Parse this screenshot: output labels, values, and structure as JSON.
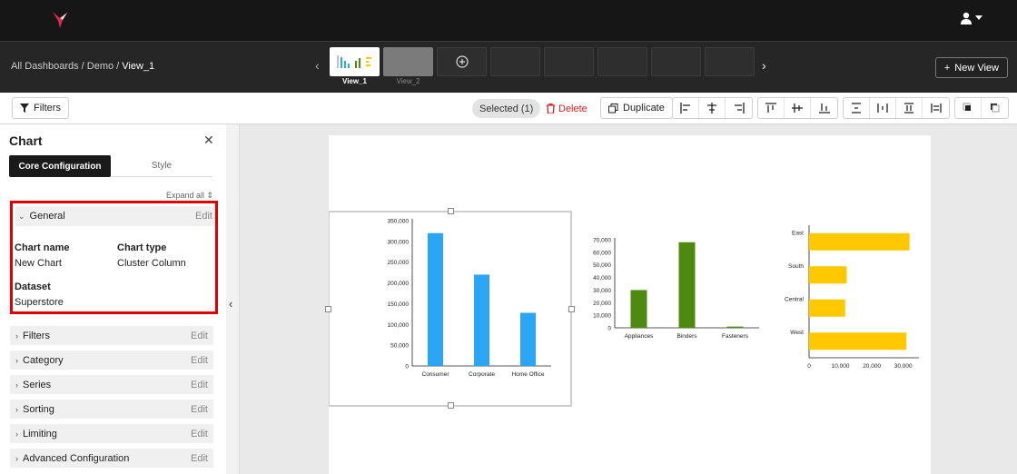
{
  "user": {
    "menu_icon": "user-icon"
  },
  "breadcrumb": {
    "root": "All Dashboards",
    "sep1": " / ",
    "middle": "Demo",
    "sep2": " / ",
    "current": "View_1"
  },
  "views": [
    {
      "label": "View_1",
      "active": true
    },
    {
      "label": "View_2",
      "active": false
    }
  ],
  "new_view_label": "New View",
  "toolbar": {
    "filters_label": "Filters",
    "selected_label": "Selected (1)",
    "delete_label": "Delete",
    "duplicate_label": "Duplicate"
  },
  "panel": {
    "title": "Chart",
    "tabs": [
      "Core Configuration",
      "Style"
    ],
    "expand_all": "Expand all",
    "general": {
      "title": "General",
      "edit": "Edit",
      "chart_name_label": "Chart name",
      "chart_name_value": "New Chart",
      "chart_type_label": "Chart type",
      "chart_type_value": "Cluster Column",
      "dataset_label": "Dataset",
      "dataset_value": "Superstore"
    },
    "sections": [
      {
        "title": "Filters",
        "edit": "Edit"
      },
      {
        "title": "Category",
        "edit": "Edit"
      },
      {
        "title": "Series",
        "edit": "Edit"
      },
      {
        "title": "Sorting",
        "edit": "Edit"
      },
      {
        "title": "Limiting",
        "edit": "Edit"
      },
      {
        "title": "Advanced Configuration",
        "edit": "Edit"
      }
    ]
  },
  "colors": {
    "blue": "#2aa6f5",
    "green": "#4f8a10",
    "yellow": "#ffc800",
    "highlight": "#e00000"
  },
  "chart_data": [
    {
      "type": "bar",
      "categories": [
        "Consumer",
        "Corporate",
        "Home Office"
      ],
      "values": [
        320000,
        220000,
        128000
      ],
      "ylim": [
        0,
        350000
      ],
      "yticks": [
        "0",
        "50,000",
        "100,000",
        "150,000",
        "200,000",
        "250,000",
        "300,000",
        "350,000"
      ]
    },
    {
      "type": "bar",
      "categories": [
        "Appliances",
        "Binders",
        "Fasteners"
      ],
      "values": [
        30000,
        68000,
        1000
      ],
      "ylim": [
        0,
        70000
      ],
      "yticks": [
        "0",
        "10,000",
        "20,000",
        "30,000",
        "40,000",
        "50,000",
        "60,000",
        "70,000"
      ]
    },
    {
      "type": "bar",
      "orientation": "horizontal",
      "categories": [
        "East",
        "South",
        "Central",
        "West"
      ],
      "values": [
        32000,
        12000,
        11500,
        31000
      ],
      "xlim": [
        0,
        35000
      ],
      "xticks": [
        "0",
        "10,000",
        "20,000",
        "30,000"
      ]
    }
  ]
}
